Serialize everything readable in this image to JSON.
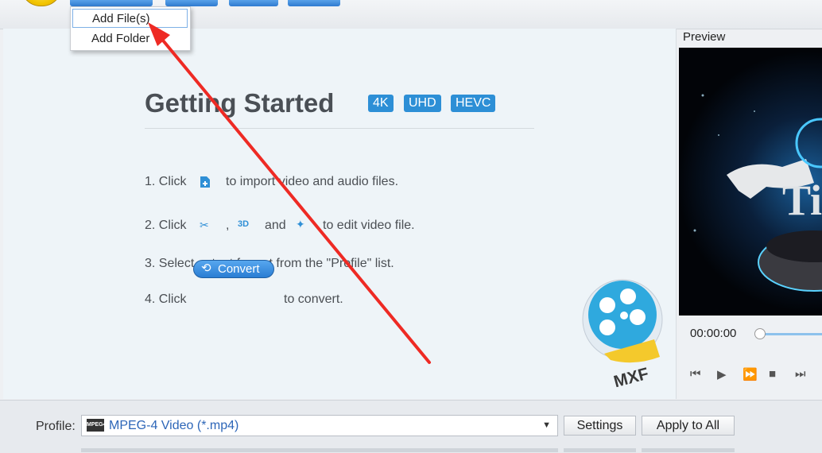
{
  "menu": {
    "items": [
      {
        "label": "Add File(s)",
        "selected": true
      },
      {
        "label": "Add Folder",
        "selected": false
      }
    ]
  },
  "getting_started": {
    "title": "Getting Started",
    "badges": [
      "4K",
      "UHD",
      "HEVC"
    ],
    "steps": {
      "s1": {
        "prefix": "1. Click",
        "suffix": "to import video and audio files."
      },
      "s2": {
        "prefix": "2. Click",
        "comma": ",",
        "and": "and",
        "suffix": "to edit video file."
      },
      "s3": {
        "text": "3. Select output format from the \"Profile\" list."
      },
      "s4": {
        "prefix": "4. Click",
        "button": "Convert",
        "suffix": "to convert."
      }
    },
    "mxf_label": "MXF"
  },
  "preview": {
    "title": "Preview",
    "time": "00:00:00"
  },
  "bottom": {
    "profile_label": "Profile:",
    "profile_value": "MPEG-4 Video (*.mp4)",
    "profile_icon_text": "MPEG4",
    "settings_label": "Settings",
    "apply_all_label": "Apply to All"
  },
  "colors": {
    "accent": "#2d8fd6",
    "annotation_arrow": "#ee2a24"
  }
}
